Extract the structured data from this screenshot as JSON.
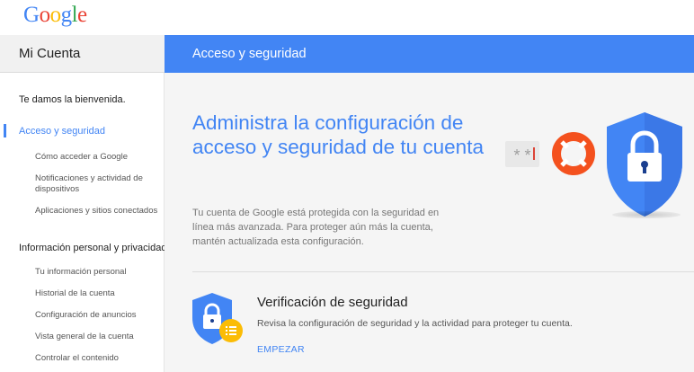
{
  "logo": {
    "text": "Google",
    "letters": [
      "G",
      "o",
      "o",
      "g",
      "l",
      "e"
    ],
    "colors": [
      "#4285f4",
      "#ea4335",
      "#fbbc05",
      "#4285f4",
      "#34a853",
      "#ea4335"
    ]
  },
  "sidebar": {
    "title": "Mi Cuenta",
    "welcome": "Te damos la bienvenida.",
    "section_security": {
      "label": "Acceso y seguridad",
      "items": [
        {
          "label": "Cómo acceder a Google"
        },
        {
          "label": "Notificaciones y actividad de dispositivos"
        },
        {
          "label": "Aplicaciones y sitios conectados"
        }
      ]
    },
    "section_info": {
      "label": "Información personal y privacidad",
      "items": [
        {
          "label": "Tu información personal"
        },
        {
          "label": "Historial de la cuenta"
        },
        {
          "label": "Configuración de anuncios"
        },
        {
          "label": "Vista general de la cuenta"
        },
        {
          "label": "Controlar el contenido"
        }
      ]
    }
  },
  "main": {
    "header_title": "Acceso y seguridad",
    "hero_title": "Administra la configuración de acceso y seguridad de tu cuenta",
    "hero_desc": "Tu cuenta de Google está protegida con la seguridad en línea más avanzada. Para proteger aún más la cuenta, mantén actualizada esta configuración.",
    "password_mask": "* *",
    "icons": [
      "password-field-icon",
      "lifebuoy-icon",
      "shield-lock-icon"
    ],
    "checkup": {
      "title": "Verificación de seguridad",
      "desc": "Revisa la configuración de seguridad y la actividad para proteger tu cuenta.",
      "button": "EMPEZAR",
      "icon": "security-checkup-shield-icon"
    }
  },
  "colors": {
    "accent": "#4285f4",
    "header_bg": "#4285f4",
    "sidebar_header_bg": "#f1f1f1",
    "main_bg": "#f5f5f5",
    "lifebuoy": "#f4511e",
    "badge": "#fbbc05"
  }
}
